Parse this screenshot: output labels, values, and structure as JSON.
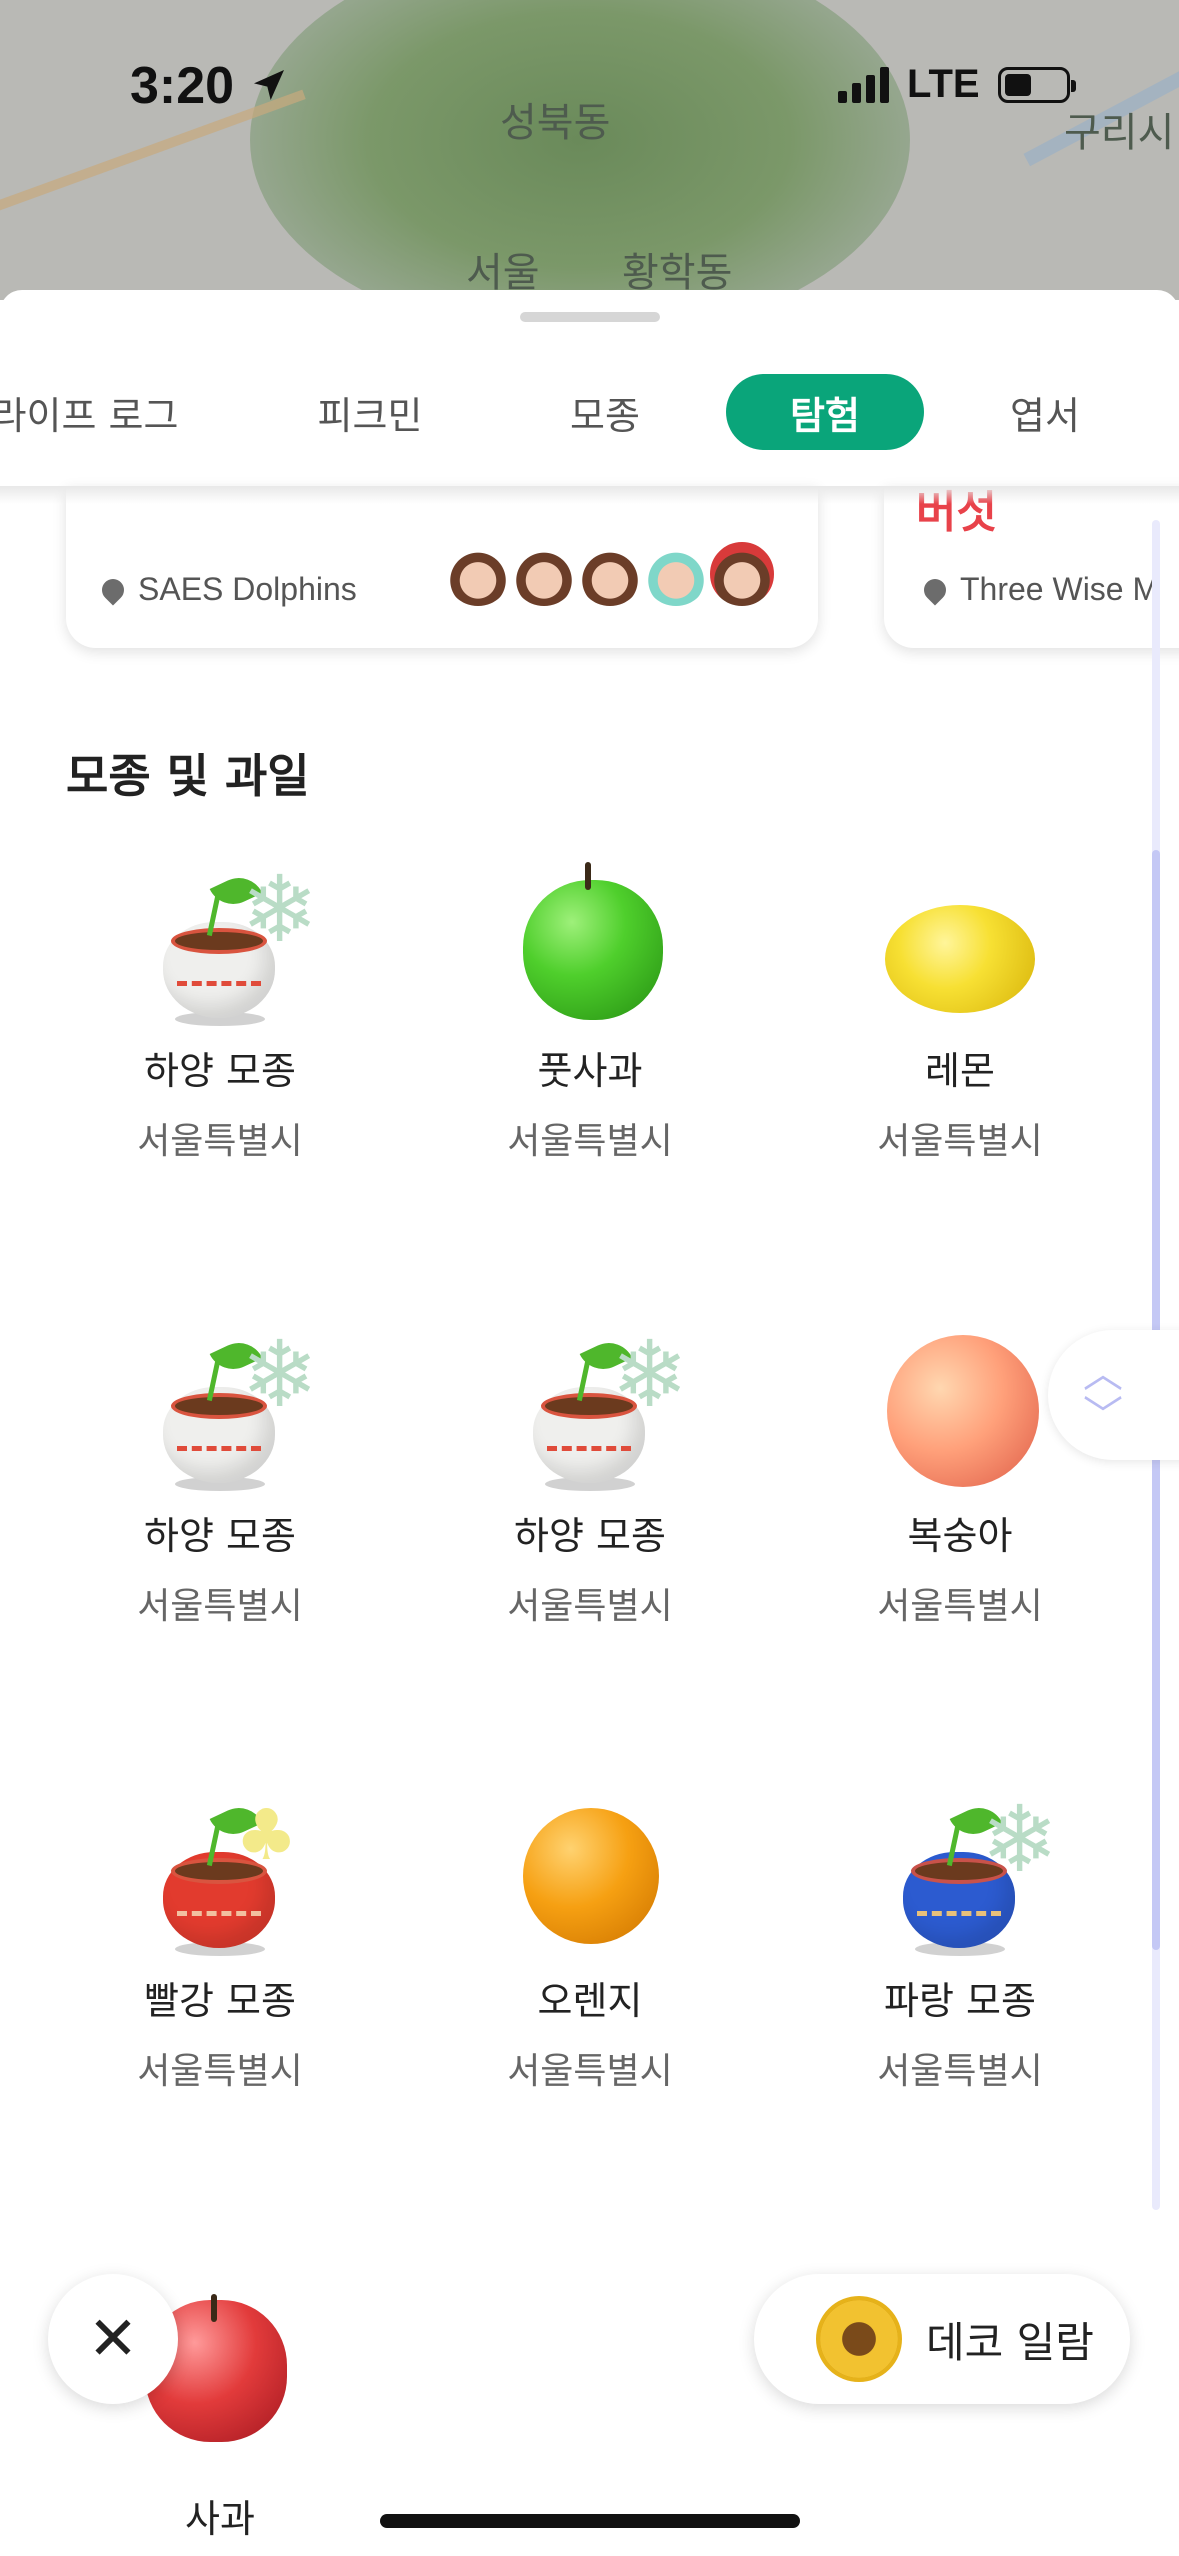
{
  "status_bar": {
    "time": "3:20",
    "location_icon": "location-arrow-icon",
    "carrier": "LTE"
  },
  "map": {
    "labels": [
      "성북동",
      "서울",
      "황학동",
      "구리시"
    ]
  },
  "tabs": [
    {
      "label": "라이프 로그",
      "active": false
    },
    {
      "label": "피크민",
      "active": false
    },
    {
      "label": "모종",
      "active": false
    },
    {
      "label": "탐험",
      "active": true
    },
    {
      "label": "엽서",
      "active": false
    }
  ],
  "cards": [
    {
      "location": "SAES Dolphins"
    },
    {
      "title": "버섯",
      "location": "Three Wise M"
    }
  ],
  "section": {
    "title": "모종 및 과일"
  },
  "items": [
    {
      "name": "하양 모종",
      "location": "서울특별시"
    },
    {
      "name": "풋사과",
      "location": "서울특별시"
    },
    {
      "name": "레몬",
      "location": "서울특별시"
    },
    {
      "name": "하양 모종",
      "location": "서울특별시"
    },
    {
      "name": "하양 모종",
      "location": "서울특별시"
    },
    {
      "name": "복숭아",
      "location": "서울특별시"
    },
    {
      "name": "빨강 모종",
      "location": "서울특별시"
    },
    {
      "name": "오렌지",
      "location": "서울특별시"
    },
    {
      "name": "파랑 모종",
      "location": "서울특별시"
    },
    {
      "name": "사과"
    }
  ],
  "buttons": {
    "close_icon": "close-icon",
    "deco_label": "데코 일람"
  },
  "colors": {
    "accent": "#0aa57a",
    "mushroom_title": "#e8424a"
  }
}
